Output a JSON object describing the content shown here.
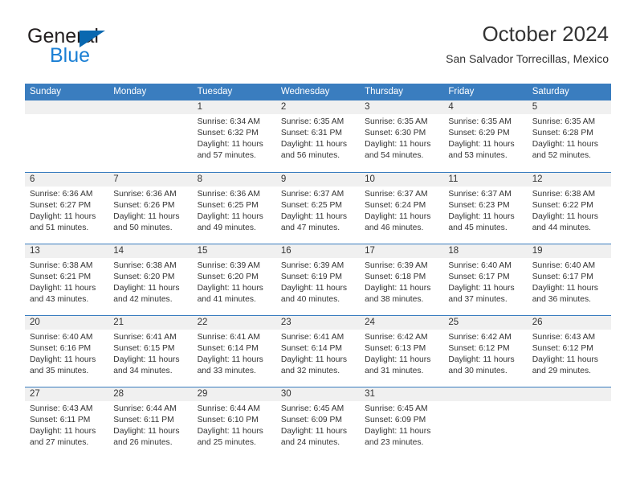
{
  "logo": {
    "word_top": "General",
    "word_bottom": "Blue",
    "triangle_color": "#0a68b0",
    "blue_text_color": "#1a7fd4"
  },
  "header": {
    "title": "October 2024",
    "subtitle": "San Salvador Torrecillas, Mexico"
  },
  "theme": {
    "header_bar": "#3a7dbf",
    "day_band": "#f0f0f0",
    "text": "#333333"
  },
  "weekdays": [
    "Sunday",
    "Monday",
    "Tuesday",
    "Wednesday",
    "Thursday",
    "Friday",
    "Saturday"
  ],
  "weeks": [
    [
      {
        "day": "",
        "sunrise": "",
        "sunset": "",
        "daylight_a": "",
        "daylight_b": ""
      },
      {
        "day": "",
        "sunrise": "",
        "sunset": "",
        "daylight_a": "",
        "daylight_b": ""
      },
      {
        "day": "1",
        "sunrise": "Sunrise: 6:34 AM",
        "sunset": "Sunset: 6:32 PM",
        "daylight_a": "Daylight: 11 hours",
        "daylight_b": "and 57 minutes."
      },
      {
        "day": "2",
        "sunrise": "Sunrise: 6:35 AM",
        "sunset": "Sunset: 6:31 PM",
        "daylight_a": "Daylight: 11 hours",
        "daylight_b": "and 56 minutes."
      },
      {
        "day": "3",
        "sunrise": "Sunrise: 6:35 AM",
        "sunset": "Sunset: 6:30 PM",
        "daylight_a": "Daylight: 11 hours",
        "daylight_b": "and 54 minutes."
      },
      {
        "day": "4",
        "sunrise": "Sunrise: 6:35 AM",
        "sunset": "Sunset: 6:29 PM",
        "daylight_a": "Daylight: 11 hours",
        "daylight_b": "and 53 minutes."
      },
      {
        "day": "5",
        "sunrise": "Sunrise: 6:35 AM",
        "sunset": "Sunset: 6:28 PM",
        "daylight_a": "Daylight: 11 hours",
        "daylight_b": "and 52 minutes."
      }
    ],
    [
      {
        "day": "6",
        "sunrise": "Sunrise: 6:36 AM",
        "sunset": "Sunset: 6:27 PM",
        "daylight_a": "Daylight: 11 hours",
        "daylight_b": "and 51 minutes."
      },
      {
        "day": "7",
        "sunrise": "Sunrise: 6:36 AM",
        "sunset": "Sunset: 6:26 PM",
        "daylight_a": "Daylight: 11 hours",
        "daylight_b": "and 50 minutes."
      },
      {
        "day": "8",
        "sunrise": "Sunrise: 6:36 AM",
        "sunset": "Sunset: 6:25 PM",
        "daylight_a": "Daylight: 11 hours",
        "daylight_b": "and 49 minutes."
      },
      {
        "day": "9",
        "sunrise": "Sunrise: 6:37 AM",
        "sunset": "Sunset: 6:25 PM",
        "daylight_a": "Daylight: 11 hours",
        "daylight_b": "and 47 minutes."
      },
      {
        "day": "10",
        "sunrise": "Sunrise: 6:37 AM",
        "sunset": "Sunset: 6:24 PM",
        "daylight_a": "Daylight: 11 hours",
        "daylight_b": "and 46 minutes."
      },
      {
        "day": "11",
        "sunrise": "Sunrise: 6:37 AM",
        "sunset": "Sunset: 6:23 PM",
        "daylight_a": "Daylight: 11 hours",
        "daylight_b": "and 45 minutes."
      },
      {
        "day": "12",
        "sunrise": "Sunrise: 6:38 AM",
        "sunset": "Sunset: 6:22 PM",
        "daylight_a": "Daylight: 11 hours",
        "daylight_b": "and 44 minutes."
      }
    ],
    [
      {
        "day": "13",
        "sunrise": "Sunrise: 6:38 AM",
        "sunset": "Sunset: 6:21 PM",
        "daylight_a": "Daylight: 11 hours",
        "daylight_b": "and 43 minutes."
      },
      {
        "day": "14",
        "sunrise": "Sunrise: 6:38 AM",
        "sunset": "Sunset: 6:20 PM",
        "daylight_a": "Daylight: 11 hours",
        "daylight_b": "and 42 minutes."
      },
      {
        "day": "15",
        "sunrise": "Sunrise: 6:39 AM",
        "sunset": "Sunset: 6:20 PM",
        "daylight_a": "Daylight: 11 hours",
        "daylight_b": "and 41 minutes."
      },
      {
        "day": "16",
        "sunrise": "Sunrise: 6:39 AM",
        "sunset": "Sunset: 6:19 PM",
        "daylight_a": "Daylight: 11 hours",
        "daylight_b": "and 40 minutes."
      },
      {
        "day": "17",
        "sunrise": "Sunrise: 6:39 AM",
        "sunset": "Sunset: 6:18 PM",
        "daylight_a": "Daylight: 11 hours",
        "daylight_b": "and 38 minutes."
      },
      {
        "day": "18",
        "sunrise": "Sunrise: 6:40 AM",
        "sunset": "Sunset: 6:17 PM",
        "daylight_a": "Daylight: 11 hours",
        "daylight_b": "and 37 minutes."
      },
      {
        "day": "19",
        "sunrise": "Sunrise: 6:40 AM",
        "sunset": "Sunset: 6:17 PM",
        "daylight_a": "Daylight: 11 hours",
        "daylight_b": "and 36 minutes."
      }
    ],
    [
      {
        "day": "20",
        "sunrise": "Sunrise: 6:40 AM",
        "sunset": "Sunset: 6:16 PM",
        "daylight_a": "Daylight: 11 hours",
        "daylight_b": "and 35 minutes."
      },
      {
        "day": "21",
        "sunrise": "Sunrise: 6:41 AM",
        "sunset": "Sunset: 6:15 PM",
        "daylight_a": "Daylight: 11 hours",
        "daylight_b": "and 34 minutes."
      },
      {
        "day": "22",
        "sunrise": "Sunrise: 6:41 AM",
        "sunset": "Sunset: 6:14 PM",
        "daylight_a": "Daylight: 11 hours",
        "daylight_b": "and 33 minutes."
      },
      {
        "day": "23",
        "sunrise": "Sunrise: 6:41 AM",
        "sunset": "Sunset: 6:14 PM",
        "daylight_a": "Daylight: 11 hours",
        "daylight_b": "and 32 minutes."
      },
      {
        "day": "24",
        "sunrise": "Sunrise: 6:42 AM",
        "sunset": "Sunset: 6:13 PM",
        "daylight_a": "Daylight: 11 hours",
        "daylight_b": "and 31 minutes."
      },
      {
        "day": "25",
        "sunrise": "Sunrise: 6:42 AM",
        "sunset": "Sunset: 6:12 PM",
        "daylight_a": "Daylight: 11 hours",
        "daylight_b": "and 30 minutes."
      },
      {
        "day": "26",
        "sunrise": "Sunrise: 6:43 AM",
        "sunset": "Sunset: 6:12 PM",
        "daylight_a": "Daylight: 11 hours",
        "daylight_b": "and 29 minutes."
      }
    ],
    [
      {
        "day": "27",
        "sunrise": "Sunrise: 6:43 AM",
        "sunset": "Sunset: 6:11 PM",
        "daylight_a": "Daylight: 11 hours",
        "daylight_b": "and 27 minutes."
      },
      {
        "day": "28",
        "sunrise": "Sunrise: 6:44 AM",
        "sunset": "Sunset: 6:11 PM",
        "daylight_a": "Daylight: 11 hours",
        "daylight_b": "and 26 minutes."
      },
      {
        "day": "29",
        "sunrise": "Sunrise: 6:44 AM",
        "sunset": "Sunset: 6:10 PM",
        "daylight_a": "Daylight: 11 hours",
        "daylight_b": "and 25 minutes."
      },
      {
        "day": "30",
        "sunrise": "Sunrise: 6:45 AM",
        "sunset": "Sunset: 6:09 PM",
        "daylight_a": "Daylight: 11 hours",
        "daylight_b": "and 24 minutes."
      },
      {
        "day": "31",
        "sunrise": "Sunrise: 6:45 AM",
        "sunset": "Sunset: 6:09 PM",
        "daylight_a": "Daylight: 11 hours",
        "daylight_b": "and 23 minutes."
      },
      {
        "day": "",
        "sunrise": "",
        "sunset": "",
        "daylight_a": "",
        "daylight_b": ""
      },
      {
        "day": "",
        "sunrise": "",
        "sunset": "",
        "daylight_a": "",
        "daylight_b": ""
      }
    ]
  ]
}
